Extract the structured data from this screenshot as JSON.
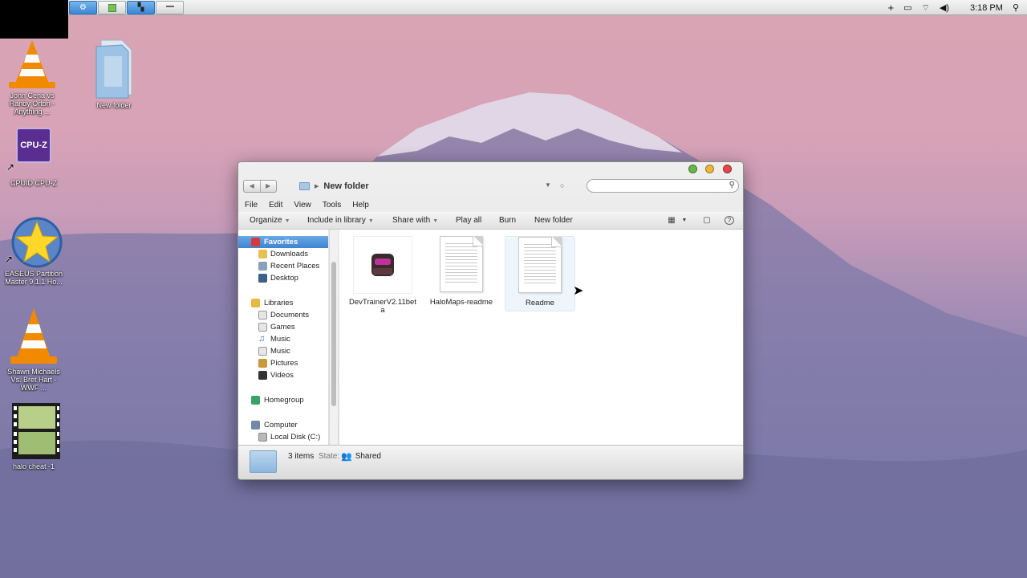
{
  "taskbar": {
    "tray": {
      "time": "3:18 PM"
    }
  },
  "desktop": {
    "icons": [
      {
        "label": "John Cena vs Randy Orton - Anything ..."
      },
      {
        "label": "New folder"
      },
      {
        "label": "CPUID CPU-Z"
      },
      {
        "label": "EASEUS Partition Master 9.1.1 Ho..."
      },
      {
        "label": "Shawn Michaels Vs. Bret Hart - WWF ..."
      },
      {
        "label": "halo cheat -1"
      }
    ],
    "cpuz_text": "CPU-Z"
  },
  "window": {
    "address": {
      "crumb": "New folder"
    },
    "search": {
      "placeholder": ""
    },
    "menu": [
      "File",
      "Edit",
      "View",
      "Tools",
      "Help"
    ],
    "commands": {
      "organize": "Organize",
      "include": "Include in library",
      "share": "Share with",
      "play": "Play all",
      "burn": "Burn",
      "newfolder": "New folder"
    },
    "nav": {
      "favorites": "Favorites",
      "downloads": "Downloads",
      "recent": "Recent Places",
      "desktop": "Desktop",
      "libraries": "Libraries",
      "documents": "Documents",
      "games": "Games",
      "music1": "Music",
      "music2": "Music",
      "pictures": "Pictures",
      "videos": "Videos",
      "homegroup": "Homegroup",
      "computer": "Computer",
      "localdisk": "Local Disk (C:)"
    },
    "files": [
      {
        "name": "DevTrainerV2.11beta"
      },
      {
        "name": "HaloMaps-readme"
      },
      {
        "name": "Readme"
      }
    ],
    "status": {
      "count": "3 items",
      "state_label": "State:",
      "shared": "Shared"
    }
  },
  "colors": {
    "selection": "#4a8fd8",
    "close": "#e0484a",
    "minimize": "#f0b43c",
    "zoom": "#6bb34a"
  }
}
